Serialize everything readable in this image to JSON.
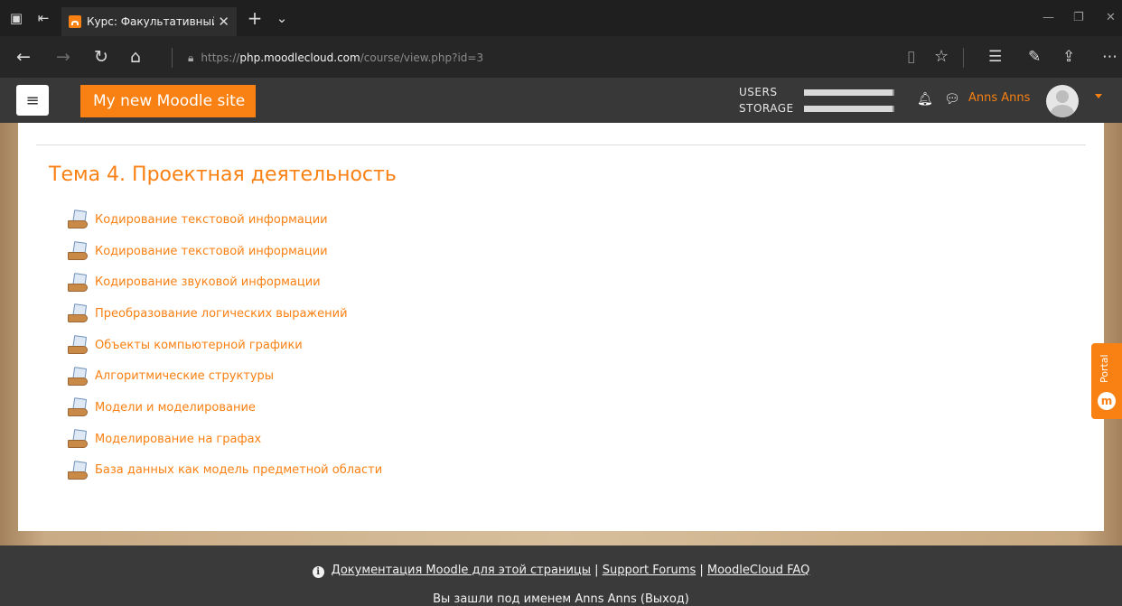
{
  "browser": {
    "tab_title": "Курс: Факультативный :",
    "url_scheme": "https://",
    "url_domain": "php.moodlecloud.com",
    "url_path": "/course/view.php?id=3"
  },
  "navbar": {
    "site_name": "My new Moodle site",
    "quota": [
      {
        "label": "USERS",
        "fraction": 0.98
      },
      {
        "label": "STORAGE",
        "fraction": 0.98
      }
    ],
    "user_name": "Anns Anns"
  },
  "section": {
    "title": "Тема 4. Проектная деятельность",
    "activities": [
      {
        "label": "Кодирование текстовой информации"
      },
      {
        "label": "Кодирование текстовой информации"
      },
      {
        "label": "Кодирование звуковой информации"
      },
      {
        "label": "Преобразование логических выражений"
      },
      {
        "label": "Объекты компьютерной графики"
      },
      {
        "label": "Алгоритмические структуры"
      },
      {
        "label": "Модели и моделирование"
      },
      {
        "label": "Моделирование на графах"
      },
      {
        "label": "База данных как модель предметной области"
      }
    ]
  },
  "portal": {
    "label": "Portal"
  },
  "footer": {
    "doc_link": "Документация Moodle для этой страницы",
    "sep": "|",
    "forums_link": "Support Forums",
    "faq_link": "MoodleCloud FAQ",
    "login_info": "Вы зашли под именем Anns Anns (Выход)"
  },
  "colors": {
    "accent": "#f98012",
    "navbar": "#383838",
    "footer": "#3a3a3a"
  }
}
